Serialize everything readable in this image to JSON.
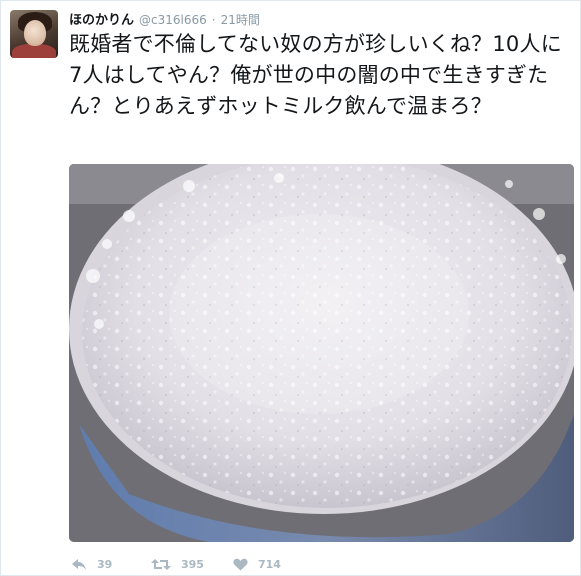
{
  "tweet": {
    "display_name": "ほのかりん",
    "handle": "@c316l666",
    "separator": "·",
    "time_ago": "21時間",
    "text": "既婚者で不倫してない奴の方が珍しいくね？10人に7人はしてやん？俺が世の中の闇の中で生きすぎたん？とりあえずホットミルク飲んで温まろ？"
  },
  "actions": {
    "reply_count": "39",
    "retweet_count": "395",
    "like_count": "714"
  },
  "icons": {
    "reply": "reply-icon",
    "retweet": "retweet-icon",
    "like": "heart-icon"
  },
  "colors": {
    "text": "#14171a",
    "meta": "#8899a6",
    "action": "#aab8c2"
  }
}
